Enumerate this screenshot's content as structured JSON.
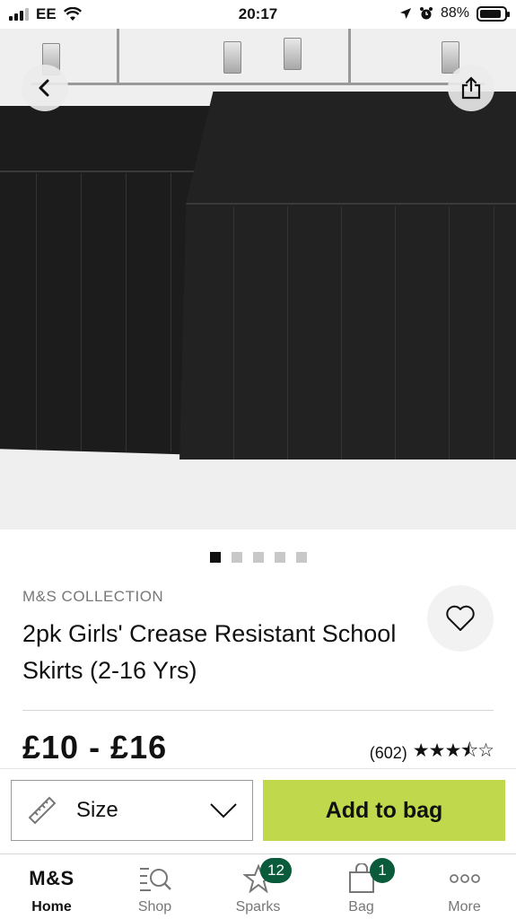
{
  "status_bar": {
    "carrier": "EE",
    "time": "20:17",
    "battery": "88%",
    "battery_level": 0.88
  },
  "icons": {
    "back": "chevron-left-icon",
    "share": "share-icon",
    "wishlist": "heart-icon",
    "size": "ruler-icon",
    "dropdown": "chevron-down-icon"
  },
  "carousel": {
    "total": 5,
    "active_index": 0
  },
  "product": {
    "brand": "M&S COLLECTION",
    "title": "2pk Girls' Crease Resistant School Skirts (2-16 Yrs)",
    "price": "£10 - £16",
    "review_count": "(602)",
    "rating": 3.5,
    "stars_text": "★★★⯪☆"
  },
  "actions": {
    "size_label": "Size",
    "add_to_bag_label": "Add to bag"
  },
  "tabs": [
    {
      "label": "Home",
      "icon": "ms-logo",
      "icon_text": "M&S",
      "active": true
    },
    {
      "label": "Shop",
      "icon": "search-list-icon",
      "active": false
    },
    {
      "label": "Sparks",
      "icon": "star-icon",
      "badge": "12",
      "active": false
    },
    {
      "label": "Bag",
      "icon": "bag-icon",
      "badge": "1",
      "active": false
    },
    {
      "label": "More",
      "icon": "more-dots-icon",
      "active": false
    }
  ],
  "colors": {
    "accent_green": "#c0d84b",
    "badge_green": "#0a5a3c"
  }
}
